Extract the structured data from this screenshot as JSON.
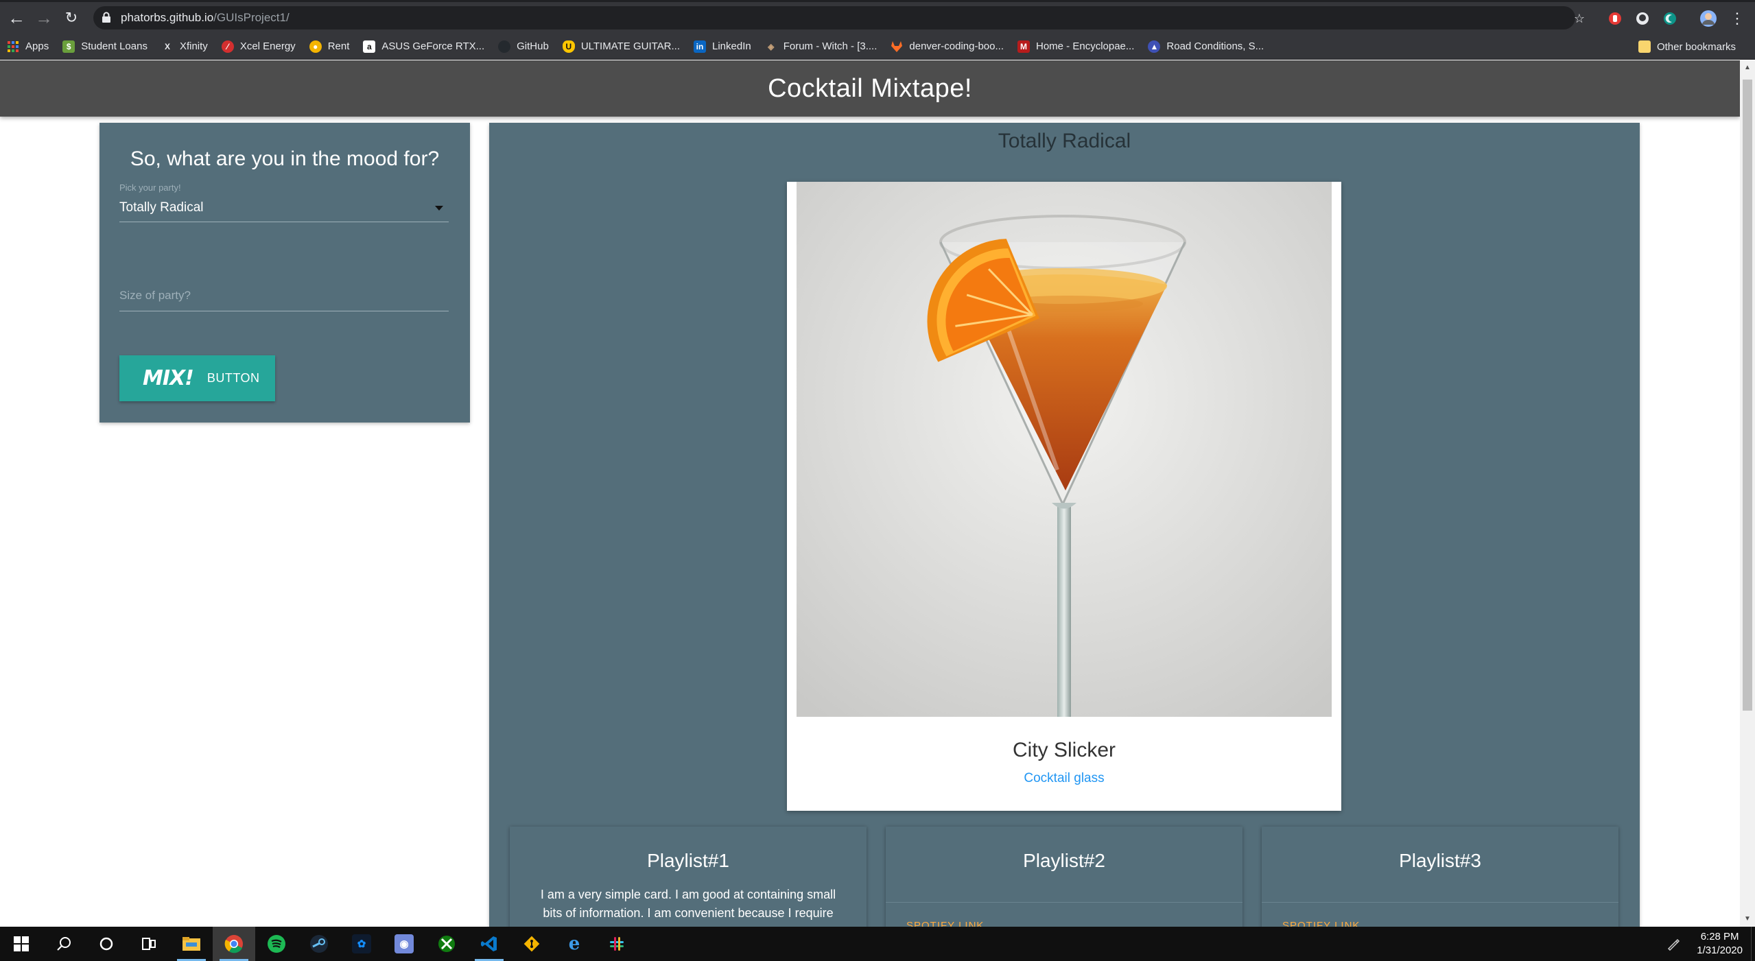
{
  "browser": {
    "url_host": "phatorbs.github.io",
    "url_path": "/GUIsProject1/",
    "bookmarks": [
      {
        "label": "Apps",
        "icon": "apps-grid-icon",
        "color": "#e94235"
      },
      {
        "label": "Student Loans",
        "icon": "student-loans-icon",
        "color": "#6a9f3c"
      },
      {
        "label": "Xfinity",
        "icon": "xfinity-icon",
        "color": "#35363a"
      },
      {
        "label": "Xcel Energy",
        "icon": "xcel-energy-icon",
        "color": "#d32f2f"
      },
      {
        "label": "Rent",
        "icon": "rent-icon",
        "color": "#f4b400"
      },
      {
        "label": "ASUS GeForce RTX...",
        "icon": "amazon-icon",
        "color": "#ffffff"
      },
      {
        "label": "GitHub",
        "icon": "github-icon",
        "color": "#24292e"
      },
      {
        "label": "ULTIMATE GUITAR...",
        "icon": "ultimate-guitar-icon",
        "color": "#ffc600"
      },
      {
        "label": "LinkedIn",
        "icon": "linkedin-icon",
        "color": "#0a66c2"
      },
      {
        "label": "Forum - Witch - [3....",
        "icon": "forum-icon",
        "color": "#8d6e63"
      },
      {
        "label": "denver-coding-boo...",
        "icon": "gitlab-icon",
        "color": "#fc6d26"
      },
      {
        "label": "Home - Encyclopae...",
        "icon": "encyclopaedia-icon",
        "color": "#b71c1c"
      },
      {
        "label": "Road Conditions, S...",
        "icon": "road-conditions-icon",
        "color": "#3f51b5"
      }
    ],
    "other_bookmarks": "Other bookmarks"
  },
  "header": {
    "title": "Cocktail Mixtape!"
  },
  "mood_form": {
    "title": "So, what are you in the mood for?",
    "party_label": "Pick your party!",
    "party_value": "Totally Radical",
    "size_placeholder": "Size of party?",
    "mix_logo": "MIX!",
    "mix_label": "BUTTON"
  },
  "result": {
    "title": "Totally Radical",
    "drink_name": "City Slicker",
    "drink_glass": "Cocktail glass"
  },
  "playlists": [
    {
      "title": "Playlist#1",
      "body": "I am a very simple card. I am good at containing small bits of information. I am convenient because I require"
    },
    {
      "title": "Playlist#2",
      "link": "SPOTIFY LINK"
    },
    {
      "title": "Playlist#3",
      "link": "SPOTIFY LINK"
    }
  ],
  "taskbar": {
    "time": "6:28 PM",
    "date": "1/31/2020",
    "apps": [
      {
        "name": "windows-start-icon"
      },
      {
        "name": "search-icon"
      },
      {
        "name": "cortana-icon"
      },
      {
        "name": "task-view-icon"
      },
      {
        "name": "file-explorer-icon"
      },
      {
        "name": "chrome-icon"
      },
      {
        "name": "spotify-icon"
      },
      {
        "name": "steam-icon"
      },
      {
        "name": "battlenet-icon"
      },
      {
        "name": "discord-icon"
      },
      {
        "name": "xbox-icon"
      },
      {
        "name": "vscode-icon"
      },
      {
        "name": "git-icon"
      },
      {
        "name": "edge-icon"
      },
      {
        "name": "slack-icon"
      }
    ]
  },
  "colors": {
    "panel": "#546e7a",
    "header": "#4d4d4d",
    "accent_button": "#26a69a",
    "link": "#2196f3"
  }
}
